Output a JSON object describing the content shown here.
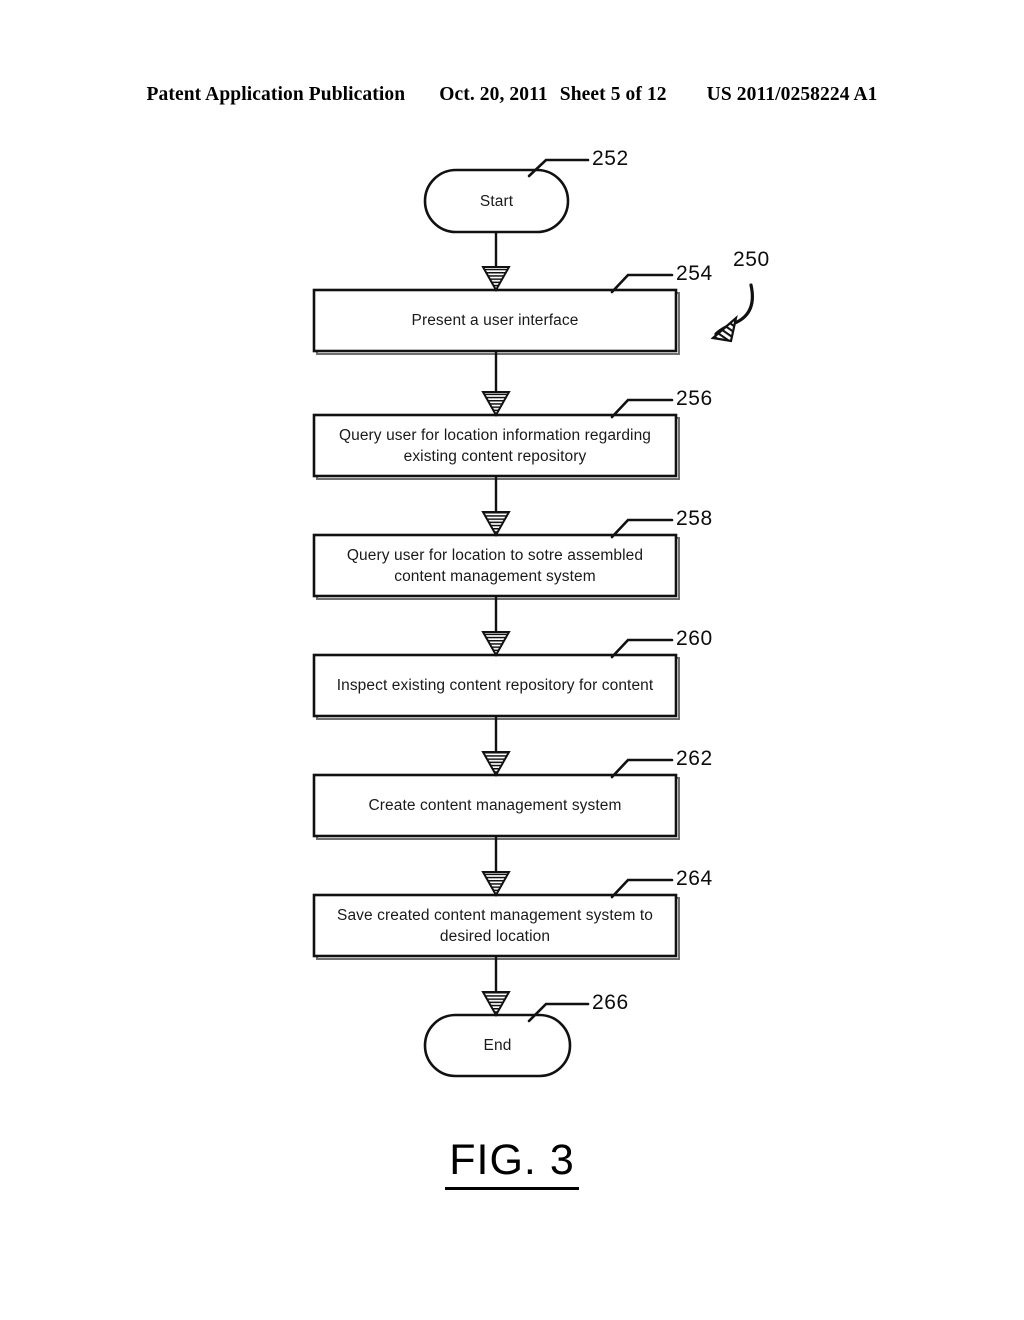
{
  "header": {
    "publication": "Patent Application Publication",
    "date": "Oct. 20, 2011",
    "sheet": "Sheet 5 of 12",
    "patent_number": "US 2011/0258224 A1"
  },
  "figure": {
    "caption": "FIG. 3",
    "diagram_ref": "250",
    "diagram_ref_name": "flowchart-reference-numeral"
  },
  "flowchart": {
    "type": "flowchart",
    "orientation": "vertical",
    "nodes": [
      {
        "id": "252",
        "shape": "terminator",
        "text": "Start",
        "ref": "252"
      },
      {
        "id": "254",
        "shape": "process",
        "text": "Present a user interface",
        "ref": "254"
      },
      {
        "id": "256",
        "shape": "process",
        "text": "Query user for location information regarding existing content repository",
        "line1": "Query user for location information regarding",
        "line2": "existing content repository",
        "ref": "256"
      },
      {
        "id": "258",
        "shape": "process",
        "text": "Query user for location to sotre assembled content management system",
        "line1": "Query user for location to sotre assembled",
        "line2": "content management system",
        "ref": "258"
      },
      {
        "id": "260",
        "shape": "process",
        "text": "Inspect existing content repository for content",
        "ref": "260"
      },
      {
        "id": "262",
        "shape": "process",
        "text": "Create content management system",
        "ref": "262"
      },
      {
        "id": "264",
        "shape": "process",
        "text": "Save created content management system to desired location",
        "line1": "Save created content management system to",
        "line2": "desired location",
        "ref": "264"
      },
      {
        "id": "266",
        "shape": "terminator",
        "text": "End",
        "ref": "266"
      }
    ],
    "edges": [
      {
        "from": "252",
        "to": "254"
      },
      {
        "from": "254",
        "to": "256"
      },
      {
        "from": "256",
        "to": "258"
      },
      {
        "from": "258",
        "to": "260"
      },
      {
        "from": "260",
        "to": "262"
      },
      {
        "from": "262",
        "to": "264"
      },
      {
        "from": "264",
        "to": "266"
      }
    ]
  },
  "colors": {
    "ink": "#000000",
    "paper": "#ffffff",
    "text": "#1a1a1a"
  }
}
